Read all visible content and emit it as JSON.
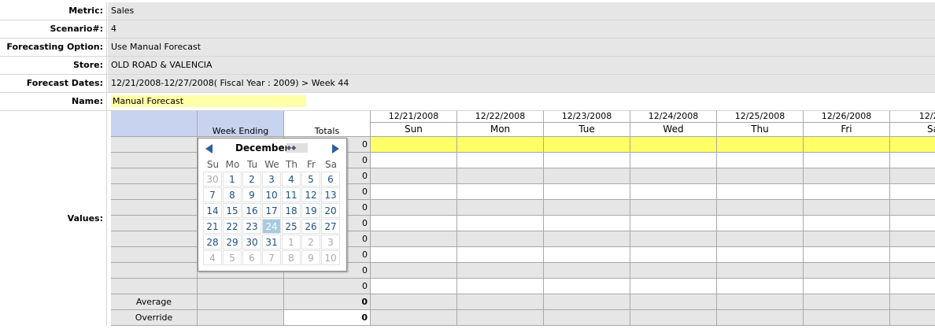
{
  "form": {
    "metric": {
      "label": "Metric:",
      "value": "Sales"
    },
    "scenario": {
      "label": "Scenario#:",
      "value": "4"
    },
    "option": {
      "label": "Forecasting Option:",
      "value": "Use Manual Forecast"
    },
    "store": {
      "label": "Store:",
      "value": "OLD ROAD & VALENCIA"
    },
    "dates": {
      "label": "Forecast Dates:",
      "value": "12/21/2008-12/27/2008( Fiscal Year : 2009) > Week 44"
    },
    "name": {
      "label": "Name:",
      "value": "Manual Forecast"
    }
  },
  "values": {
    "label": "Values:",
    "week_ending_header": "Week Ending",
    "totals_header": "Totals",
    "days": [
      {
        "date": "12/21/2008",
        "day": "Sun"
      },
      {
        "date": "12/22/2008",
        "day": "Mon"
      },
      {
        "date": "12/23/2008",
        "day": "Tue"
      },
      {
        "date": "12/24/2008",
        "day": "Wed"
      },
      {
        "date": "12/25/2008",
        "day": "Thu"
      },
      {
        "date": "12/26/2008",
        "day": "Fri"
      },
      {
        "date": "12/27/",
        "day": "Sa"
      }
    ],
    "totals": [
      "0",
      "0",
      "0",
      "0",
      "0",
      "0",
      "0",
      "0",
      "0",
      "0"
    ],
    "average_label": "Average",
    "average_total": "0",
    "override_label": "Override",
    "override_total": "0"
  },
  "calendar": {
    "month": "December",
    "weekdays": [
      "Su",
      "Mo",
      "Tu",
      "We",
      "Th",
      "Fr",
      "Sa"
    ],
    "weeks": [
      [
        "30",
        "1",
        "2",
        "3",
        "4",
        "5",
        "6"
      ],
      [
        "7",
        "8",
        "9",
        "10",
        "11",
        "12",
        "13"
      ],
      [
        "14",
        "15",
        "16",
        "17",
        "18",
        "19",
        "20"
      ],
      [
        "21",
        "22",
        "23",
        "24",
        "25",
        "26",
        "27"
      ],
      [
        "28",
        "29",
        "30",
        "31",
        "1",
        "2",
        "3"
      ],
      [
        "4",
        "5",
        "6",
        "7",
        "8",
        "9",
        "10"
      ]
    ],
    "selected": "24",
    "colors": {
      "selected_bg": "#a6cbe0",
      "day_text": "#1d4f85",
      "arrow": "#2b5fa0"
    }
  },
  "colors": {
    "header_blue": "#c8d3f0",
    "row_yellow": "#ffff66",
    "gray": "#e6e6e6",
    "name_yellow": "#ffffa8"
  }
}
